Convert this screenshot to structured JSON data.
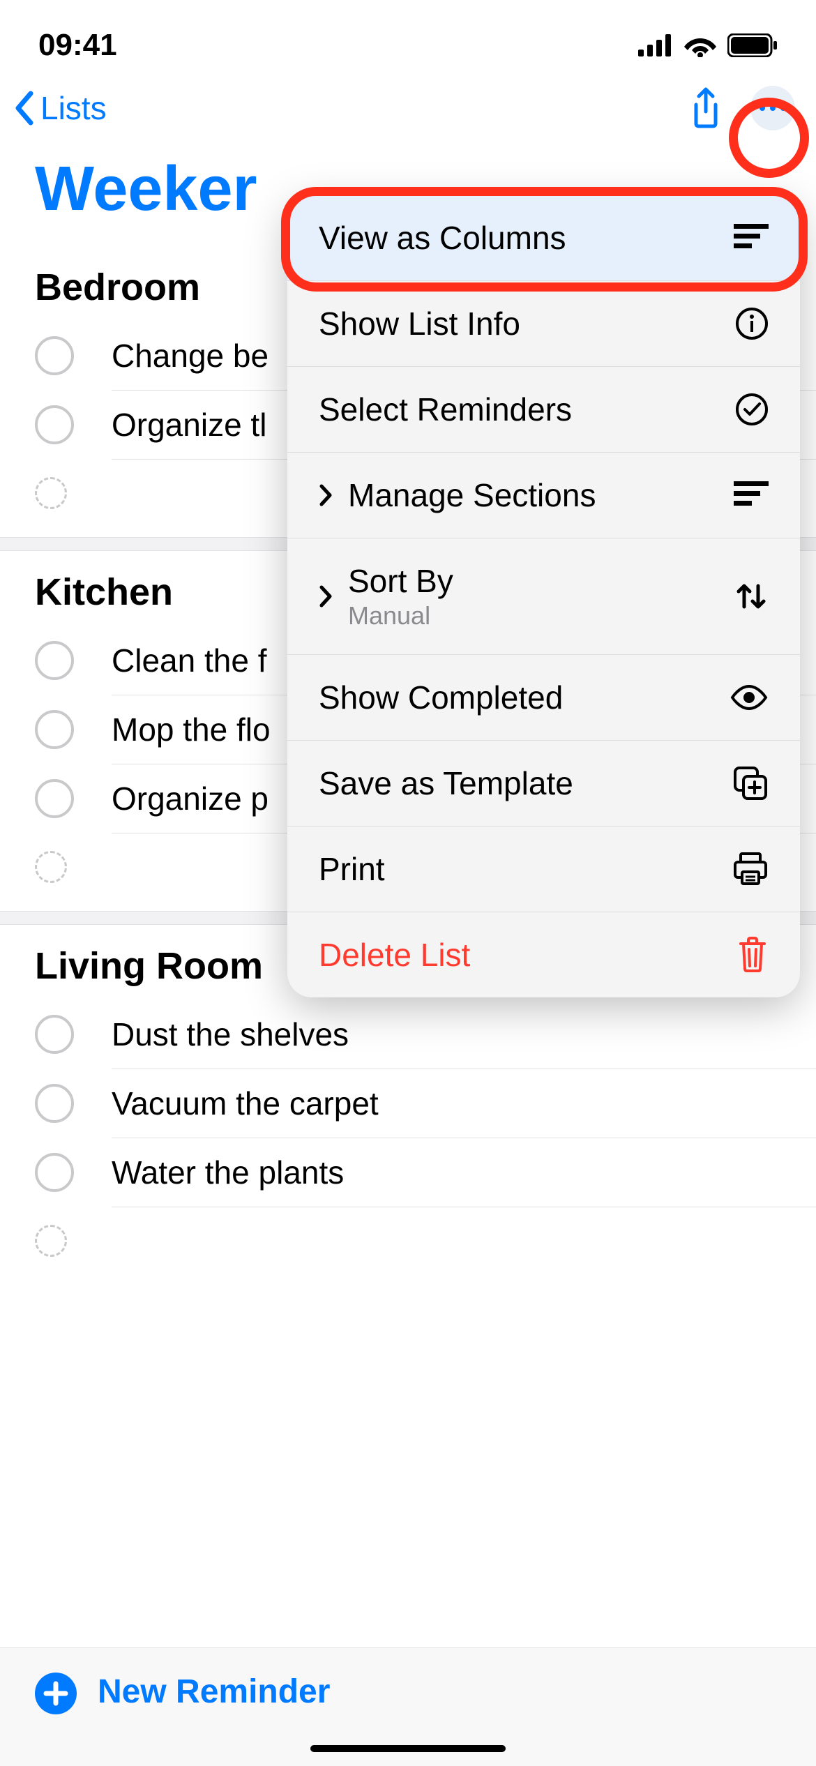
{
  "statusbar": {
    "time": "09:41"
  },
  "nav": {
    "back_label": "Lists"
  },
  "title": "Weeker",
  "sections": [
    {
      "name": "Bedroom",
      "items": [
        "Change be",
        "Organize tl"
      ]
    },
    {
      "name": "Kitchen",
      "items": [
        "Clean the f",
        "Mop the flo",
        "Organize p"
      ]
    },
    {
      "name": "Living Room",
      "items": [
        "Dust the shelves",
        "Vacuum the carpet",
        "Water the plants"
      ]
    }
  ],
  "footer": {
    "new_reminder": "New Reminder"
  },
  "menu": {
    "view_as_columns": "View as Columns",
    "show_list_info": "Show List Info",
    "select_reminders": "Select Reminders",
    "manage_sections": "Manage Sections",
    "sort_by": "Sort By",
    "sort_by_value": "Manual",
    "show_completed": "Show Completed",
    "save_as_template": "Save as Template",
    "print": "Print",
    "delete_list": "Delete List"
  }
}
